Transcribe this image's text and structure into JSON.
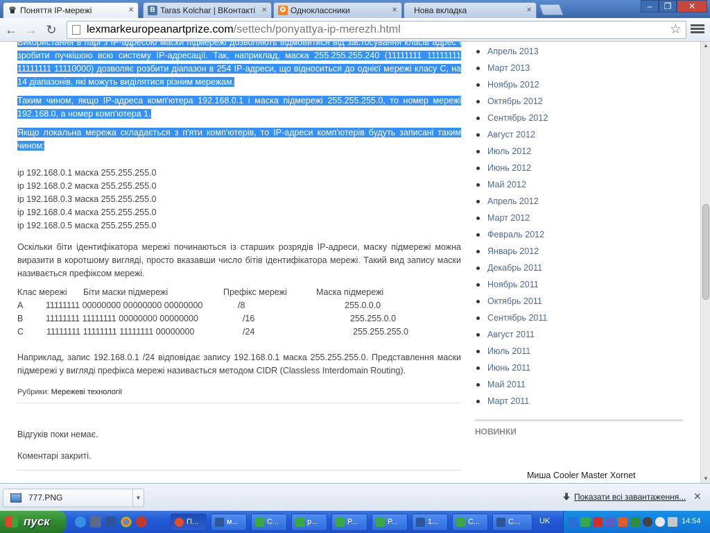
{
  "browser": {
    "tabs": [
      {
        "title": "Поняття IP-мережі",
        "fav": "crown-icon",
        "fav_color": "#333333",
        "active": true
      },
      {
        "title": "Taras Kolchar | ВКонтакті",
        "fav": "B",
        "fav_color": "#4a76a8",
        "active": false
      },
      {
        "title": "Одноклассники",
        "fav": "ok-icon",
        "fav_color": "#f5841f",
        "active": false
      },
      {
        "title": "Нова вкладка",
        "fav": "",
        "fav_color": "#ffffff",
        "active": false
      }
    ],
    "url_host": "lexmarkeuropeanartprize.com",
    "url_path": "/settech/ponyattya-ip-merezh.html"
  },
  "article": {
    "p1": "Використання в парі з IP-адресою маски підмережі дозволяють відмовитися від застосування класів адрес і зробити пучкішою всю систему IP-адресації. Так, наприклад, маска 255.255.255.240 (11111111 11111111 11111111 11110000) дозволяє розбити діапазон в 254 IP-адреси, що відноситься до однієї мережі класу C, на 14 діапазонів, які можуть виділятися різним мережам.",
    "p2": "Таким чином, якщо IP-адреса комп'ютера 192.168.0.1 і маска підмережі 255.255.255.0, то номер мережі 192.168.0, а номер комп'ютера 1.",
    "p3": "Якщо локальна мережа складається з п'яти комп'ютерів, то IP-адреси комп'ютерів будуть записані таким чином:",
    "ip_lines": [
      "ip 192.168.0.1 маска 255.255.255.0",
      "ip 192.168.0.2 маска 255.255.255.0",
      "ip 192.168.0.3 маска 255.255.255.0",
      "ip 192.168.0.4 маска 255.255.255.0",
      "ip 192.168.0.5 маска 255.255.255.0"
    ],
    "p4": "Оскільки біти ідентифікатора мережі починаються із старших розрядів IP-адреси, маску підмережі можна виразити в коротшому вигляді, просто вказавши число бітів ідентифікатора мережі. Такий вид запису маски називається префіксом мережі.",
    "table": {
      "headers": [
        "Клас мережі",
        "Біти маски підмережі",
        "Префікс мережі",
        "Маска підмережі"
      ],
      "rows": [
        [
          "A",
          "11111111  00000000  00000000  00000000",
          "/8",
          "255.0.0.0"
        ],
        [
          "B",
          "11111111  11111111  00000000  00000000",
          "/16",
          "255.255.0.0"
        ],
        [
          "C",
          "11111111  11111111  11111111  00000000",
          "/24",
          "255.255.255.0"
        ]
      ]
    },
    "p5": "Наприклад, запис 192.168.0.1 /24 відповідає запису 192.168.0.1 маска 255.255.255.0. Представлення маски підмережі у вигляді префікса мережі називається методом CIDR (Classless Interdomain Routing).",
    "categories_label": "Рубрики:",
    "category": "Мережеві технології",
    "no_comments": "Відгуків поки немає.",
    "comments_closed": "Коментарі закриті."
  },
  "sidebar": {
    "archive": [
      "Апрель 2013",
      "Март 2013",
      "Ноябрь 2012",
      "Октябрь 2012",
      "Сентябрь 2012",
      "Август 2012",
      "Июль 2012",
      "Июнь 2012",
      "Май 2012",
      "Апрель 2012",
      "Март 2012",
      "Февраль 2012",
      "Январь 2012",
      "Декабрь 2011",
      "Ноябрь 2011",
      "Октябрь 2011",
      "Сентябрь 2011",
      "Август 2011",
      "Июль 2011",
      "Июнь 2011",
      "Май 2011",
      "Март 2011"
    ],
    "news_title": "НОВИНКИ",
    "news_item": "Миша Cooler Master Xornet"
  },
  "downloads": {
    "file": "777.PNG",
    "show_all": "Показати всі завантаження..."
  },
  "taskbar": {
    "start": "пуск",
    "buttons": [
      {
        "label": "П...",
        "color": "#e44d26",
        "active": true
      },
      {
        "label": "м...",
        "color": "#2b579a",
        "active": false
      },
      {
        "label": "С...",
        "color": "#39a845",
        "active": false
      },
      {
        "label": "р...",
        "color": "#39a845",
        "active": false
      },
      {
        "label": "Р...",
        "color": "#39a845",
        "active": false
      },
      {
        "label": "Р...",
        "color": "#39a845",
        "active": false
      },
      {
        "label": "1...",
        "color": "#2b579a",
        "active": false
      },
      {
        "label": "С...",
        "color": "#39a845",
        "active": false
      },
      {
        "label": "С...",
        "color": "#2b579a",
        "active": false
      }
    ],
    "lang": "UK",
    "clock": "14:54"
  }
}
